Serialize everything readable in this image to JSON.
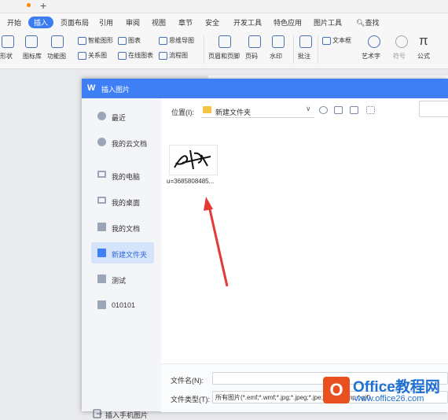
{
  "tabs": {
    "new_tab_label": "+"
  },
  "menu": {
    "items": [
      "开始",
      "插入",
      "页面布局",
      "引用",
      "审阅",
      "视图",
      "章节",
      "安全",
      "开发工具",
      "特色应用",
      "图片工具"
    ],
    "search_label": "查找"
  },
  "ribbon": {
    "shape": "形状",
    "icon_lib": "图标库",
    "func_chart": "功能图",
    "smart_art": "智能图形",
    "chart": "图表",
    "mind_map": "思维导图",
    "relation": "关系图",
    "online_chart": "在线图表",
    "flow_chart": "流程图",
    "header_footer": "页眉和页脚",
    "page_num": "页码",
    "watermark": "水印",
    "comment": "批注",
    "textbox": "文本框",
    "art_text": "艺术字",
    "symbol": "符号",
    "formula": "公式"
  },
  "dialog": {
    "title": "插入图片",
    "logo": "W",
    "sidebar": [
      {
        "label": "最近",
        "icon": "clock-icon"
      },
      {
        "label": "我的云文档",
        "icon": "cloud-doc-icon"
      },
      {
        "label": "我的电脑",
        "icon": "computer-icon"
      },
      {
        "label": "我的桌面",
        "icon": "desktop-icon"
      },
      {
        "label": "我的文档",
        "icon": "folder-icon"
      },
      {
        "label": "新建文件夹",
        "icon": "folder-icon"
      },
      {
        "label": "测试",
        "icon": "folder-icon"
      },
      {
        "label": "010101",
        "icon": "folder-icon"
      }
    ],
    "selected_index": 5,
    "phone_images": "插入手机图片",
    "location_label": "位置(I):",
    "location_value": "新建文件夹",
    "file_item_name": "u=3685808485...",
    "filename_label": "文件名(N):",
    "filetype_label": "文件类型(T):",
    "filetype_value": "所有图片(*.emf;*.wmf;*.jpg;*.jpeg;*.jpe;*.png;*.bmp;*.gif)"
  },
  "watermark": {
    "brand": "Office教程网",
    "site": "www.office26.com",
    "badge": "O"
  },
  "colors": {
    "accent": "#3f7ff5",
    "arrow": "#e53935",
    "brand": "#e8501f"
  }
}
